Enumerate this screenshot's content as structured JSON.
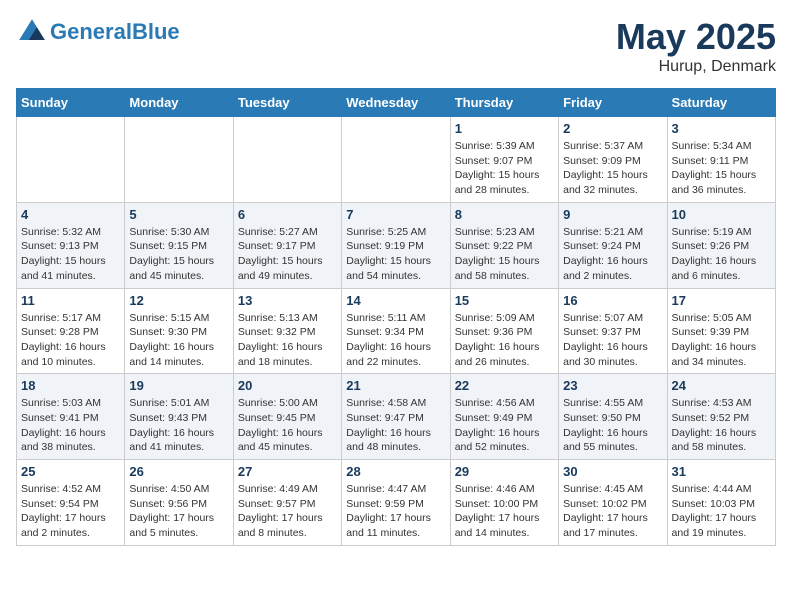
{
  "header": {
    "logo_line1": "General",
    "logo_line2": "Blue",
    "month": "May 2025",
    "location": "Hurup, Denmark"
  },
  "weekdays": [
    "Sunday",
    "Monday",
    "Tuesday",
    "Wednesday",
    "Thursday",
    "Friday",
    "Saturday"
  ],
  "weeks": [
    [
      {
        "day": "",
        "info": ""
      },
      {
        "day": "",
        "info": ""
      },
      {
        "day": "",
        "info": ""
      },
      {
        "day": "",
        "info": ""
      },
      {
        "day": "1",
        "info": "Sunrise: 5:39 AM\nSunset: 9:07 PM\nDaylight: 15 hours\nand 28 minutes."
      },
      {
        "day": "2",
        "info": "Sunrise: 5:37 AM\nSunset: 9:09 PM\nDaylight: 15 hours\nand 32 minutes."
      },
      {
        "day": "3",
        "info": "Sunrise: 5:34 AM\nSunset: 9:11 PM\nDaylight: 15 hours\nand 36 minutes."
      }
    ],
    [
      {
        "day": "4",
        "info": "Sunrise: 5:32 AM\nSunset: 9:13 PM\nDaylight: 15 hours\nand 41 minutes."
      },
      {
        "day": "5",
        "info": "Sunrise: 5:30 AM\nSunset: 9:15 PM\nDaylight: 15 hours\nand 45 minutes."
      },
      {
        "day": "6",
        "info": "Sunrise: 5:27 AM\nSunset: 9:17 PM\nDaylight: 15 hours\nand 49 minutes."
      },
      {
        "day": "7",
        "info": "Sunrise: 5:25 AM\nSunset: 9:19 PM\nDaylight: 15 hours\nand 54 minutes."
      },
      {
        "day": "8",
        "info": "Sunrise: 5:23 AM\nSunset: 9:22 PM\nDaylight: 15 hours\nand 58 minutes."
      },
      {
        "day": "9",
        "info": "Sunrise: 5:21 AM\nSunset: 9:24 PM\nDaylight: 16 hours\nand 2 minutes."
      },
      {
        "day": "10",
        "info": "Sunrise: 5:19 AM\nSunset: 9:26 PM\nDaylight: 16 hours\nand 6 minutes."
      }
    ],
    [
      {
        "day": "11",
        "info": "Sunrise: 5:17 AM\nSunset: 9:28 PM\nDaylight: 16 hours\nand 10 minutes."
      },
      {
        "day": "12",
        "info": "Sunrise: 5:15 AM\nSunset: 9:30 PM\nDaylight: 16 hours\nand 14 minutes."
      },
      {
        "day": "13",
        "info": "Sunrise: 5:13 AM\nSunset: 9:32 PM\nDaylight: 16 hours\nand 18 minutes."
      },
      {
        "day": "14",
        "info": "Sunrise: 5:11 AM\nSunset: 9:34 PM\nDaylight: 16 hours\nand 22 minutes."
      },
      {
        "day": "15",
        "info": "Sunrise: 5:09 AM\nSunset: 9:36 PM\nDaylight: 16 hours\nand 26 minutes."
      },
      {
        "day": "16",
        "info": "Sunrise: 5:07 AM\nSunset: 9:37 PM\nDaylight: 16 hours\nand 30 minutes."
      },
      {
        "day": "17",
        "info": "Sunrise: 5:05 AM\nSunset: 9:39 PM\nDaylight: 16 hours\nand 34 minutes."
      }
    ],
    [
      {
        "day": "18",
        "info": "Sunrise: 5:03 AM\nSunset: 9:41 PM\nDaylight: 16 hours\nand 38 minutes."
      },
      {
        "day": "19",
        "info": "Sunrise: 5:01 AM\nSunset: 9:43 PM\nDaylight: 16 hours\nand 41 minutes."
      },
      {
        "day": "20",
        "info": "Sunrise: 5:00 AM\nSunset: 9:45 PM\nDaylight: 16 hours\nand 45 minutes."
      },
      {
        "day": "21",
        "info": "Sunrise: 4:58 AM\nSunset: 9:47 PM\nDaylight: 16 hours\nand 48 minutes."
      },
      {
        "day": "22",
        "info": "Sunrise: 4:56 AM\nSunset: 9:49 PM\nDaylight: 16 hours\nand 52 minutes."
      },
      {
        "day": "23",
        "info": "Sunrise: 4:55 AM\nSunset: 9:50 PM\nDaylight: 16 hours\nand 55 minutes."
      },
      {
        "day": "24",
        "info": "Sunrise: 4:53 AM\nSunset: 9:52 PM\nDaylight: 16 hours\nand 58 minutes."
      }
    ],
    [
      {
        "day": "25",
        "info": "Sunrise: 4:52 AM\nSunset: 9:54 PM\nDaylight: 17 hours\nand 2 minutes."
      },
      {
        "day": "26",
        "info": "Sunrise: 4:50 AM\nSunset: 9:56 PM\nDaylight: 17 hours\nand 5 minutes."
      },
      {
        "day": "27",
        "info": "Sunrise: 4:49 AM\nSunset: 9:57 PM\nDaylight: 17 hours\nand 8 minutes."
      },
      {
        "day": "28",
        "info": "Sunrise: 4:47 AM\nSunset: 9:59 PM\nDaylight: 17 hours\nand 11 minutes."
      },
      {
        "day": "29",
        "info": "Sunrise: 4:46 AM\nSunset: 10:00 PM\nDaylight: 17 hours\nand 14 minutes."
      },
      {
        "day": "30",
        "info": "Sunrise: 4:45 AM\nSunset: 10:02 PM\nDaylight: 17 hours\nand 17 minutes."
      },
      {
        "day": "31",
        "info": "Sunrise: 4:44 AM\nSunset: 10:03 PM\nDaylight: 17 hours\nand 19 minutes."
      }
    ]
  ]
}
